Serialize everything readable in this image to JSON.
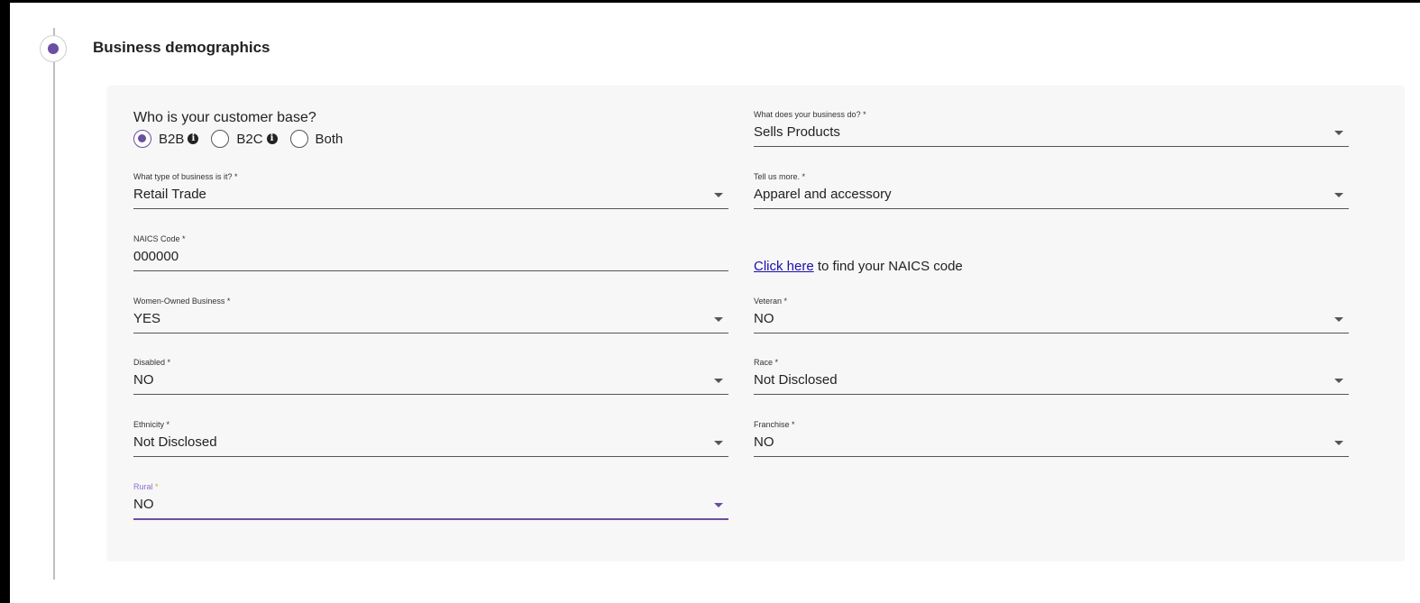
{
  "section": {
    "title": "Business demographics"
  },
  "customer_base": {
    "label": "Who is your customer base?",
    "options": [
      {
        "label": "B2B",
        "checked": true,
        "has_info": true
      },
      {
        "label": "B2C",
        "checked": false,
        "has_info": true
      },
      {
        "label": "Both",
        "checked": false,
        "has_info": false
      }
    ]
  },
  "fields": {
    "business_do": {
      "label": "What does your business do? *",
      "value": "Sells Products"
    },
    "business_type": {
      "label": "What type of business is it? *",
      "value": "Retail Trade"
    },
    "tell_more": {
      "label": "Tell us more. *",
      "value": "Apparel and accessory"
    },
    "naics": {
      "label": "NAICS Code *",
      "value": "000000"
    },
    "women_owned": {
      "label": "Women-Owned Business *",
      "value": "YES"
    },
    "veteran": {
      "label": "Veteran *",
      "value": "NO"
    },
    "disabled": {
      "label": "Disabled *",
      "value": "NO"
    },
    "race": {
      "label": "Race *",
      "value": "Not Disclosed"
    },
    "ethnicity": {
      "label": "Ethnicity *",
      "value": "Not Disclosed"
    },
    "franchise": {
      "label": "Franchise *",
      "value": "NO"
    },
    "rural": {
      "label": "Rural",
      "required_mark": "*",
      "value": "NO"
    }
  },
  "naics_help": {
    "link_text": "Click here",
    "suffix": " to find your NAICS code"
  },
  "colors": {
    "accent": "#6b4fa0",
    "link": "#1a0dab",
    "panel_bg": "#f7f7f7"
  },
  "icons": {
    "info": "info-circle-icon",
    "dropdown": "caret-down-icon"
  }
}
